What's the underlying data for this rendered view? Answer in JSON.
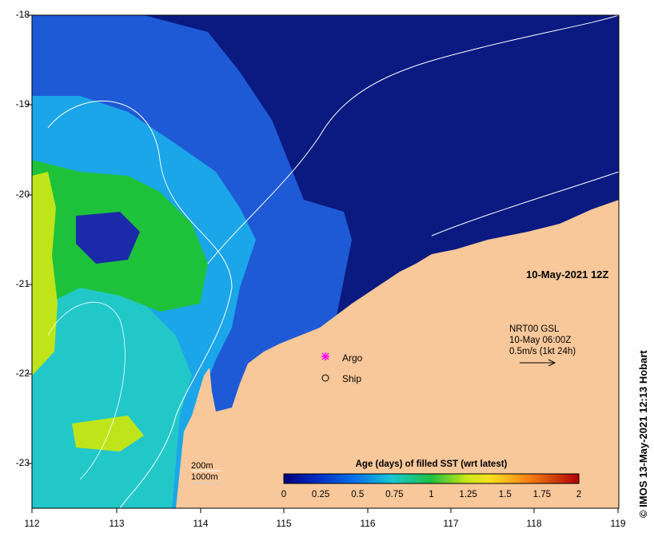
{
  "map": {
    "date_label": "10-May-2021 12Z",
    "x_ticks": [
      "112",
      "113",
      "114",
      "115",
      "116",
      "117",
      "118",
      "119"
    ],
    "y_ticks": [
      "-18",
      "-19",
      "-20",
      "-21",
      "-22",
      "-23"
    ],
    "lon_range": [
      112,
      119
    ],
    "lat_range": [
      -23.55,
      -18
    ]
  },
  "current_info": {
    "line1": "NRT00 GSL",
    "line2": "10-May 06:00Z",
    "line3": "0.5m/s (1kt 24h)"
  },
  "legend": {
    "argo_label": "Argo",
    "ship_label": "Ship"
  },
  "depth_contours": {
    "label_200": "200m",
    "label_1000": "1000m"
  },
  "colorbar": {
    "title": "Age (days) of filled SST (wrt latest)",
    "ticks": [
      "0",
      "0.25",
      "0.5",
      "0.75",
      "1",
      "1.25",
      "1.5",
      "1.75",
      "2"
    ],
    "range": [
      0,
      2
    ]
  },
  "credit": "© IMOS 13-May-2021 12:13 Hobart",
  "colors": {
    "land": "#f8c89a",
    "deep_blue": "#0a1a80",
    "mid_blue": "#1e5ad6",
    "light_blue": "#1aa6e8",
    "cyan": "#22c8c8",
    "green": "#1ec23a",
    "yellow_green": "#bfe51a"
  },
  "icons": {
    "argo": "magenta-star-icon",
    "ship": "open-circle-icon"
  }
}
